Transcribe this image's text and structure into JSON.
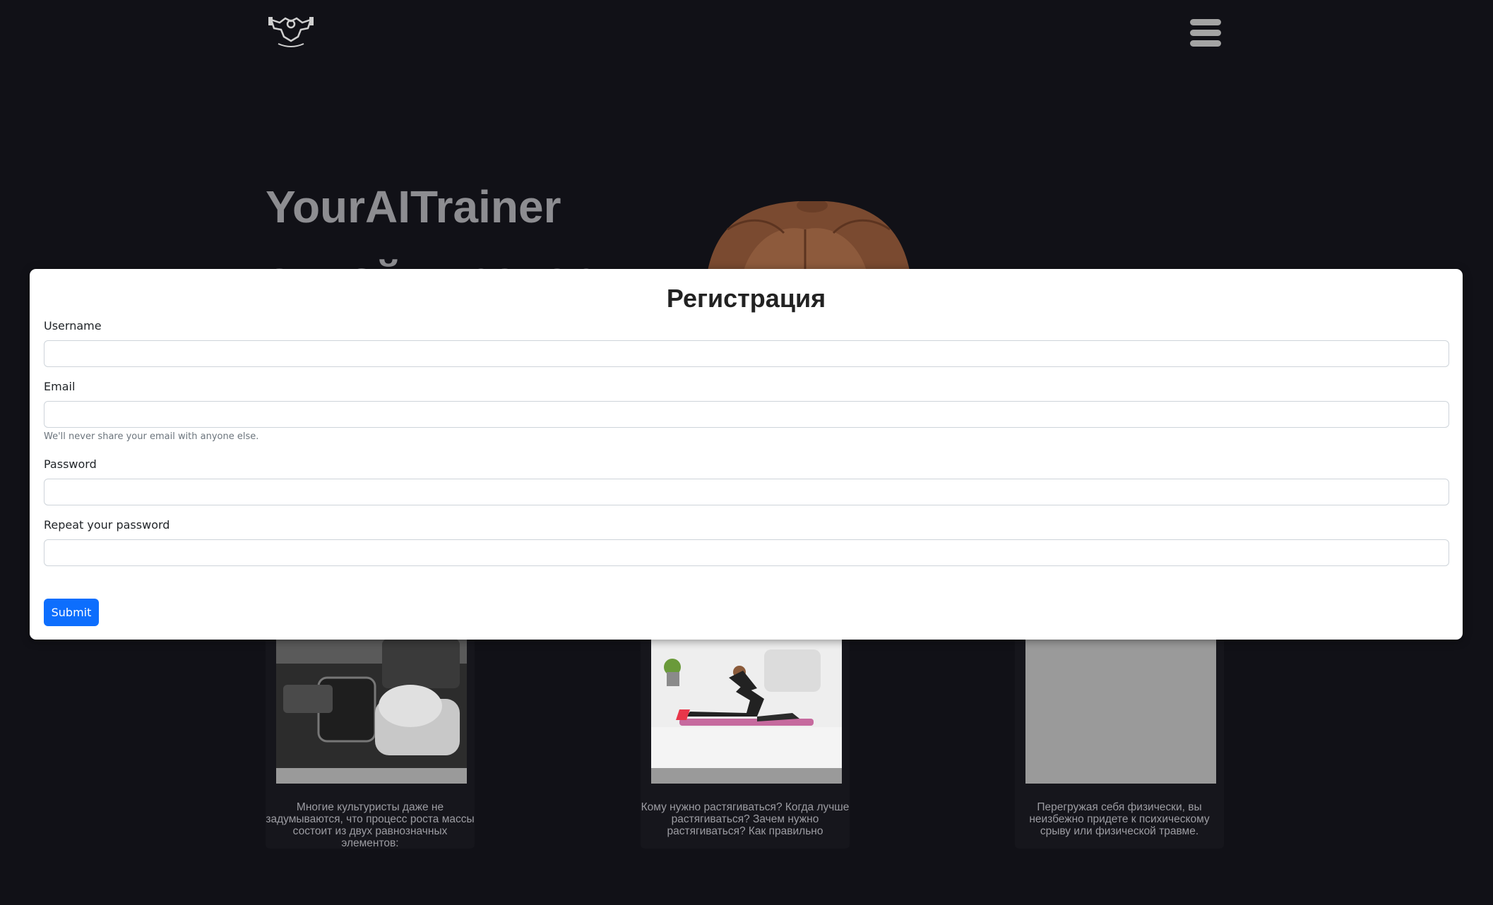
{
  "colors": {
    "page_background": "#111117",
    "hero_text": "#8d8d91",
    "card_text": "#9c9ca2",
    "modal_background": "#ffffff",
    "primary_button": "#0d6efd"
  },
  "header": {
    "logo_icon": "bodybuilder-logo-icon",
    "menu_icon": "hamburger-menu-icon"
  },
  "hero": {
    "title_line1": "YourAITrainer",
    "title_line2": "онлайн тренер"
  },
  "cards": [
    {
      "image_icon": "dumbbell-workout-photo",
      "text": "Многие культуристы даже не задумываются, что процесс роста массы состоит из двух равнозначных элементов:"
    },
    {
      "image_icon": "stretching-photo",
      "text": "Кому нужно растягиваться? Когда лучше растягиваться? Зачем нужно растягиваться? Как правильно"
    },
    {
      "image_icon": "placeholder-image",
      "text": "Перегружая себя физически, вы неизбежно придете к психическому срыву или физической травме."
    }
  ],
  "modal": {
    "title": "Регистрация",
    "fields": {
      "username": {
        "label": "Username",
        "value": ""
      },
      "email": {
        "label": "Email",
        "value": "",
        "help": "We'll never share your email with anyone else."
      },
      "password": {
        "label": "Password",
        "value": ""
      },
      "repeat_password": {
        "label": "Repeat your password",
        "value": ""
      }
    },
    "submit_label": "Submit"
  }
}
